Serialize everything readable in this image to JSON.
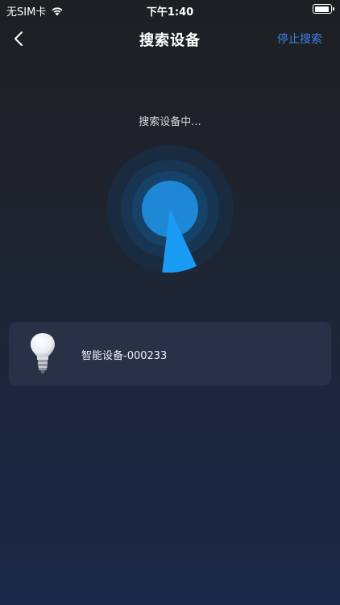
{
  "status_bar": {
    "carrier": "无SIM卡",
    "time": "下午1:40"
  },
  "nav": {
    "title": "搜索设备",
    "stop_label": "停止搜索"
  },
  "searching_text": "搜索设备中...",
  "devices": [
    {
      "name": "智能设备-000233",
      "icon": "light-bulb-icon"
    }
  ],
  "colors": {
    "accent": "#3c82e8",
    "radar_center": "#1e88d6",
    "sweep": "#1a9cf5",
    "card": "#293146"
  }
}
